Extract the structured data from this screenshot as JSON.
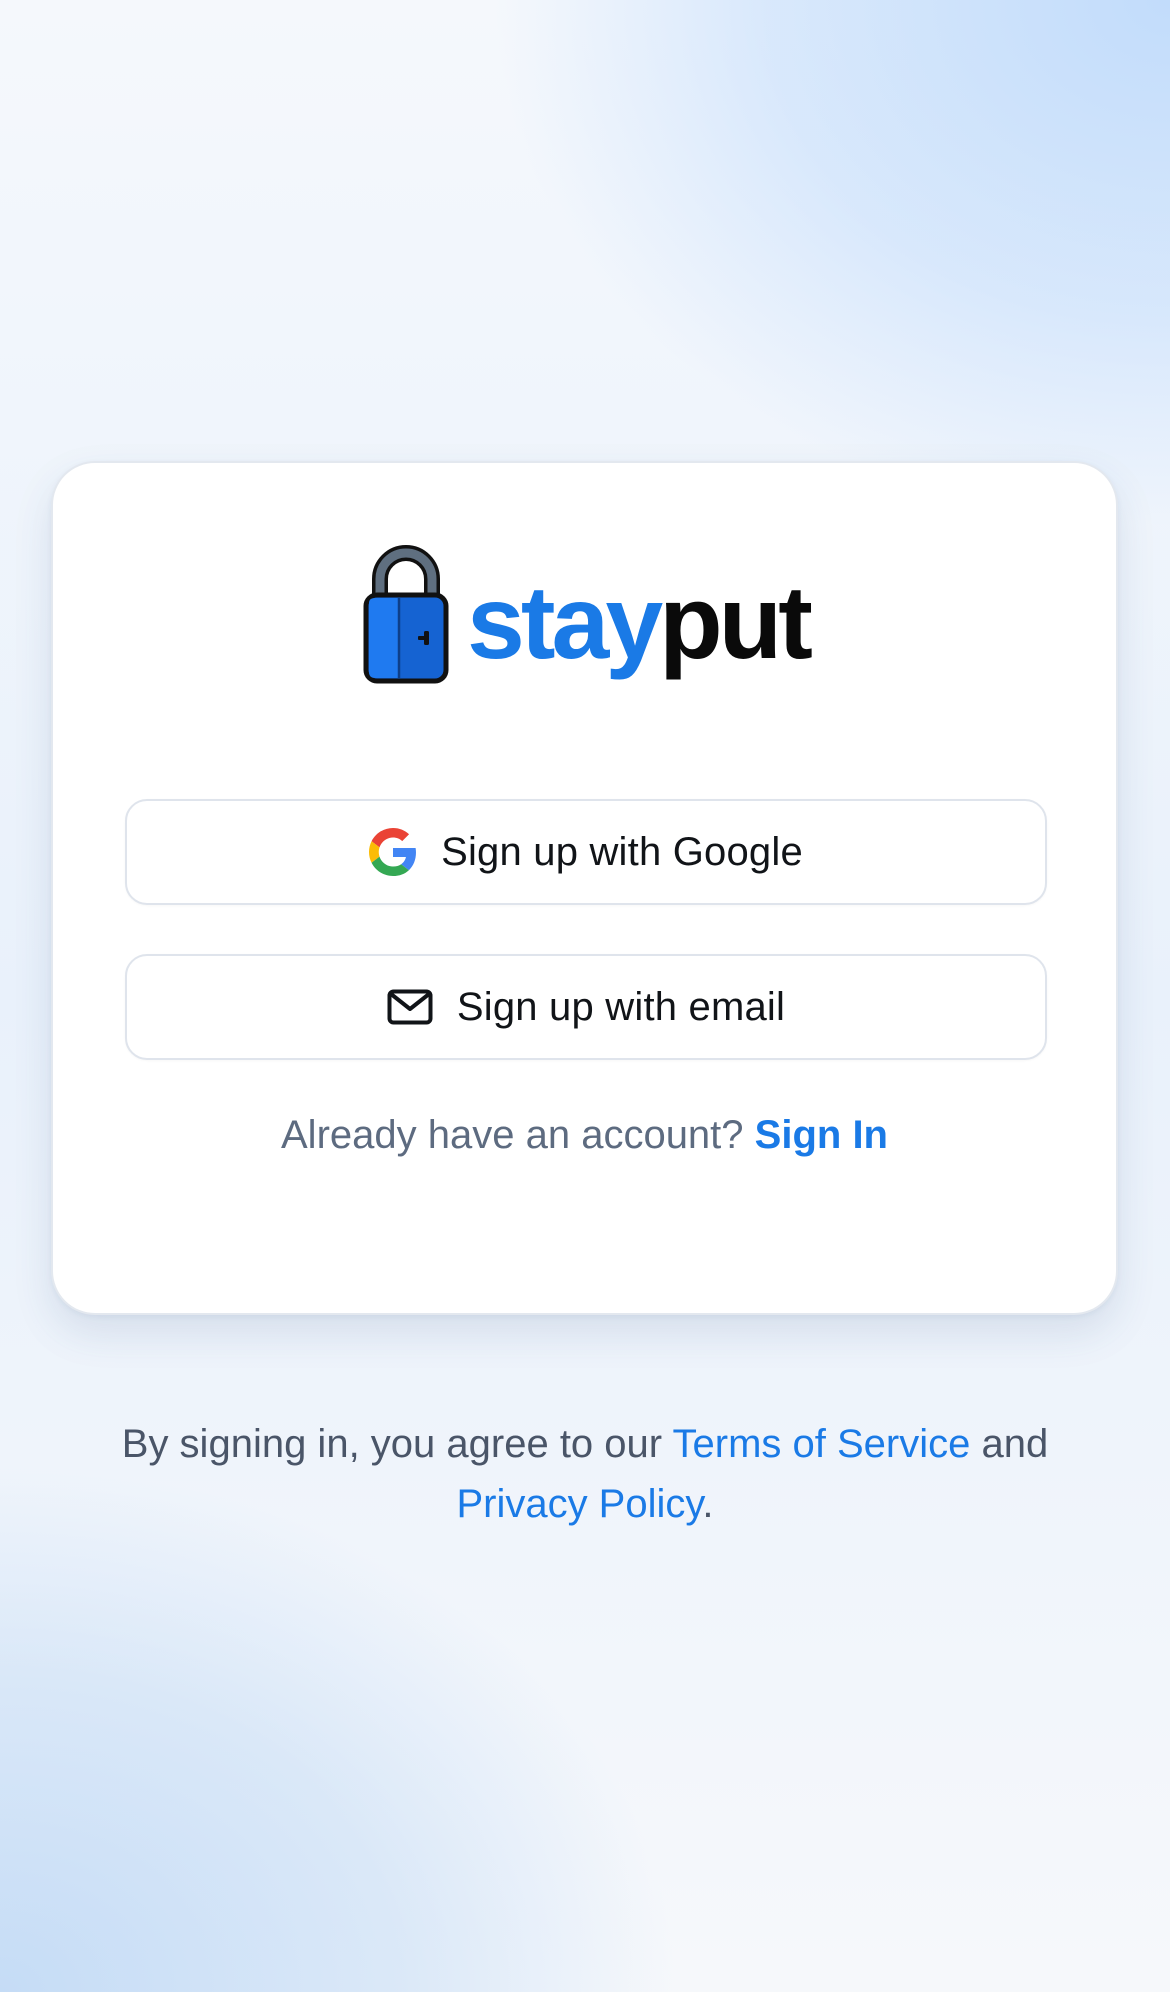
{
  "brand": {
    "word_part1": "stay",
    "word_part2": "put",
    "logo_icon": "padlock-door-icon",
    "accent_color": "#1a7ae6"
  },
  "buttons": {
    "google": {
      "label": "Sign up with Google",
      "icon": "google-icon"
    },
    "email": {
      "label": "Sign up with email",
      "icon": "mail-icon"
    }
  },
  "signin": {
    "prompt": "Already have an account?",
    "link": "Sign In"
  },
  "legal": {
    "prefix": "By signing in, you agree to our",
    "terms_link": "Terms of Service",
    "conjunction": "and",
    "privacy_link": "Privacy Policy",
    "suffix": "."
  }
}
